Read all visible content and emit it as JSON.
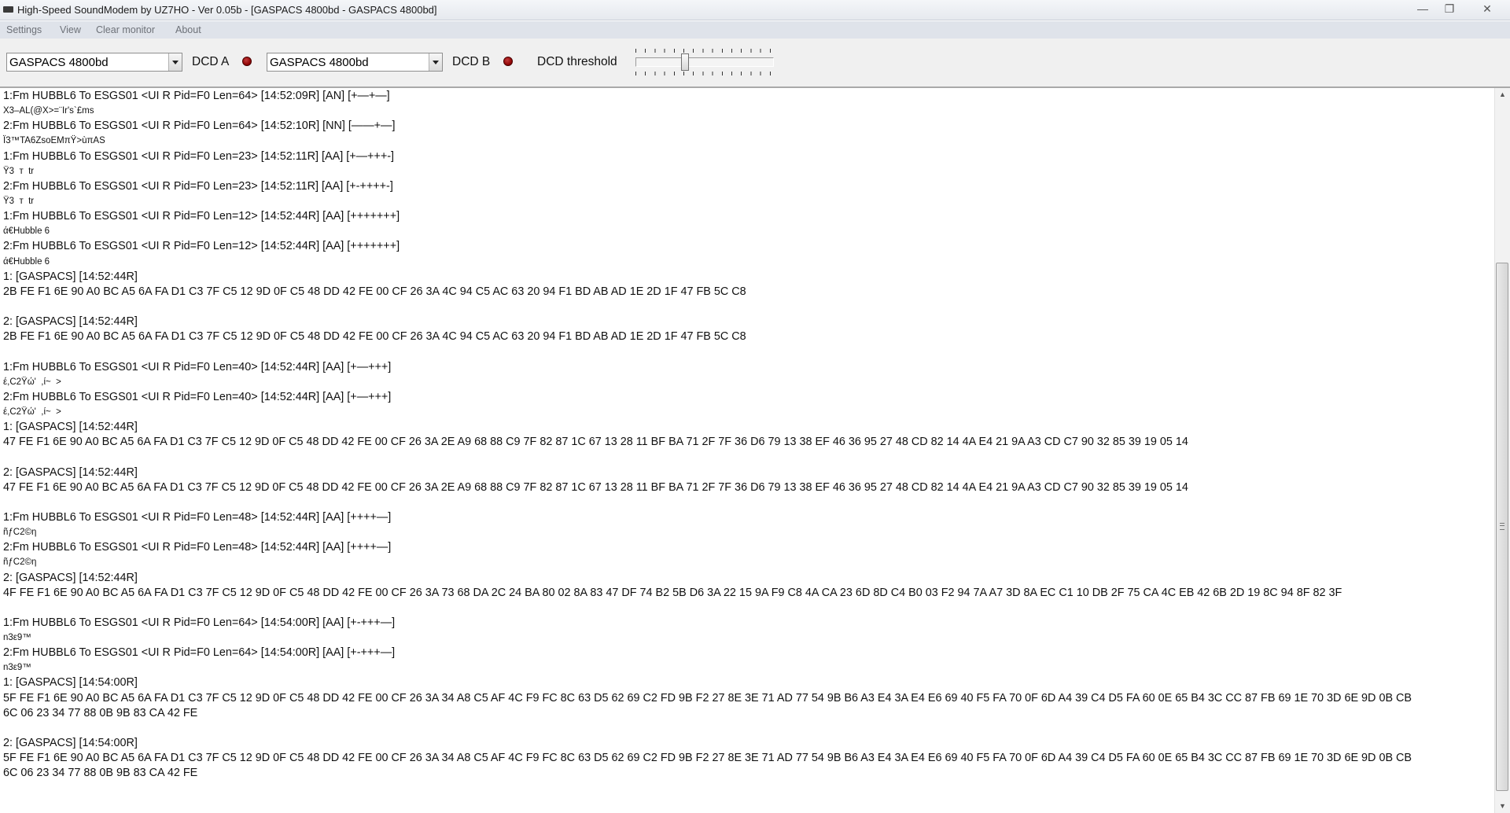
{
  "window": {
    "title": "High-Speed SoundModem by UZ7HO - Ver 0.05b - [GASPACS 4800bd - GASPACS 4800bd]",
    "controls": [
      "—",
      "❐",
      "✕"
    ]
  },
  "menu": [
    "Settings",
    "View",
    "Clear monitor",
    "About"
  ],
  "toolbar": {
    "modem_a": "GASPACS 4800bd",
    "dcd_a_label": "DCD A",
    "modem_b": "GASPACS 4800bd",
    "dcd_b_label": "DCD B",
    "dcd_threshold_label": "DCD threshold",
    "led_color": "#8b0000",
    "dcd_threshold_level": 0.35
  },
  "monitor": {
    "lines": [
      {
        "text": "1:Fm HUBBL6 To ESGS01 <UI R Pid=F0 Len=64> [14:52:09R] [AN] [+—+—]",
        "small": false
      },
      {
        "text": "X3–AL(@X>=¨Ir's`£ms",
        "small": true
      },
      {
        "text": "2:Fm HUBBL6 To ESGS01 <UI R Pid=F0 Len=64> [14:52:10R] [NN] [——+—]",
        "small": false
      },
      {
        "text": "Ï3™TA6ZsoEMπŸ>ùπAS",
        "small": true
      },
      {
        "text": "1:Fm HUBBL6 To ESGS01 <UI R Pid=F0 Len=23> [14:52:11R] [AA] [+—+++-]",
        "small": false
      },
      {
        "text": "Ÿ3  т  tr",
        "small": true
      },
      {
        "text": "2:Fm HUBBL6 To ESGS01 <UI R Pid=F0 Len=23> [14:52:11R] [AA] [+-++++-]",
        "small": false
      },
      {
        "text": "Ÿ3  т  tr",
        "small": true
      },
      {
        "text": "1:Fm HUBBL6 To ESGS01 <UI R Pid=F0 Len=12> [14:52:44R] [AA] [+++++++]",
        "small": false
      },
      {
        "text": "ά€Hubble 6",
        "small": true
      },
      {
        "text": "2:Fm HUBBL6 To ESGS01 <UI R Pid=F0 Len=12> [14:52:44R] [AA] [+++++++]",
        "small": false
      },
      {
        "text": "ά€Hubble 6",
        "small": true
      },
      {
        "text": "1: [GASPACS] [14:52:44R]",
        "small": false
      },
      {
        "text": "2B FE F1 6E 90 A0 BC A5 6A FA D1 C3 7F C5 12 9D 0F C5 48 DD 42 FE 00 CF 26 3A 4C 94 C5 AC 63 20 94 F1 BD AB AD 1E 2D 1F 47 FB 5C C8",
        "small": false
      },
      {
        "text": "",
        "small": false
      },
      {
        "text": "2: [GASPACS] [14:52:44R]",
        "small": false
      },
      {
        "text": "2B FE F1 6E 90 A0 BC A5 6A FA D1 C3 7F C5 12 9D 0F C5 48 DD 42 FE 00 CF 26 3A 4C 94 C5 AC 63 20 94 F1 BD AB AD 1E 2D 1F 47 FB 5C C8",
        "small": false
      },
      {
        "text": "",
        "small": false
      },
      {
        "text": "1:Fm HUBBL6 To ESGS01 <UI R Pid=F0 Len=40> [14:52:44R] [AA] [+—+++]",
        "small": false
      },
      {
        "text": "έ,C2Ÿώ'  ,ί~  >",
        "small": true
      },
      {
        "text": "2:Fm HUBBL6 To ESGS01 <UI R Pid=F0 Len=40> [14:52:44R] [AA] [+—+++]",
        "small": false
      },
      {
        "text": "έ,C2Ÿώ'  ,ί~  >",
        "small": true
      },
      {
        "text": "1: [GASPACS] [14:52:44R]",
        "small": false
      },
      {
        "text": "47 FE F1 6E 90 A0 BC A5 6A FA D1 C3 7F C5 12 9D 0F C5 48 DD 42 FE 00 CF 26 3A 2E A9 68 88 C9 7F 82 87 1C 67 13 28 11 BF BA 71 2F 7F 36 D6 79 13 38 EF 46 36 95 27 48 CD 82 14 4A E4 21 9A A3 CD C7 90 32 85 39 19 05 14",
        "small": false
      },
      {
        "text": "",
        "small": false
      },
      {
        "text": "2: [GASPACS] [14:52:44R]",
        "small": false
      },
      {
        "text": "47 FE F1 6E 90 A0 BC A5 6A FA D1 C3 7F C5 12 9D 0F C5 48 DD 42 FE 00 CF 26 3A 2E A9 68 88 C9 7F 82 87 1C 67 13 28 11 BF BA 71 2F 7F 36 D6 79 13 38 EF 46 36 95 27 48 CD 82 14 4A E4 21 9A A3 CD C7 90 32 85 39 19 05 14",
        "small": false
      },
      {
        "text": "",
        "small": false
      },
      {
        "text": "1:Fm HUBBL6 To ESGS01 <UI R Pid=F0 Len=48> [14:52:44R] [AA] [++++—]",
        "small": false
      },
      {
        "text": "ñƒC2©η",
        "small": true
      },
      {
        "text": "2:Fm HUBBL6 To ESGS01 <UI R Pid=F0 Len=48> [14:52:44R] [AA] [++++—]",
        "small": false
      },
      {
        "text": "ñƒC2©η",
        "small": true
      },
      {
        "text": "2: [GASPACS] [14:52:44R]",
        "small": false
      },
      {
        "text": "4F FE F1 6E 90 A0 BC A5 6A FA D1 C3 7F C5 12 9D 0F C5 48 DD 42 FE 00 CF 26 3A 73 68 DA 2C 24 BA 80 02 8A 83 47 DF 74 B2 5B D6 3A 22 15 9A F9 C8 4A CA 23 6D 8D C4 B0 03 F2 94 7A A7 3D 8A EC C1 10 DB 2F 75 CA 4C EB 42 6B 2D 19 8C 94 8F 82 3F",
        "small": false
      },
      {
        "text": "",
        "small": false
      },
      {
        "text": "1:Fm HUBBL6 To ESGS01 <UI R Pid=F0 Len=64> [14:54:00R] [AA] [+-+++—]",
        "small": false
      },
      {
        "text": "n3ε9™",
        "small": true
      },
      {
        "text": "2:Fm HUBBL6 To ESGS01 <UI R Pid=F0 Len=64> [14:54:00R] [AA] [+-+++—]",
        "small": false
      },
      {
        "text": "n3ε9™",
        "small": true
      },
      {
        "text": "1: [GASPACS] [14:54:00R]",
        "small": false
      },
      {
        "text": "5F FE F1 6E 90 A0 BC A5 6A FA D1 C3 7F C5 12 9D 0F C5 48 DD 42 FE 00 CF 26 3A 34 A8 C5 AF 4C F9 FC 8C 63 D5 62 69 C2 FD 9B F2 27 8E 3E 71 AD 77 54 9B B6 A3 E4 3A E4 E6 69 40 F5 FA 70 0F 6D A4 39 C4 D5 FA 60 0E 65 B4 3C CC 87 FB 69 1E 70 3D 6E 9D 0B CB",
        "small": false
      },
      {
        "text": "6C 06 23 34 77 88 0B 9B 83 CA 42 FE",
        "small": false
      },
      {
        "text": "",
        "small": false
      },
      {
        "text": "2: [GASPACS] [14:54:00R]",
        "small": false
      },
      {
        "text": "5F FE F1 6E 90 A0 BC A5 6A FA D1 C3 7F C5 12 9D 0F C5 48 DD 42 FE 00 CF 26 3A 34 A8 C5 AF 4C F9 FC 8C 63 D5 62 69 C2 FD 9B F2 27 8E 3E 71 AD 77 54 9B B6 A3 E4 3A E4 E6 69 40 F5 FA 70 0F 6D A4 39 C4 D5 FA 60 0E 65 B4 3C CC 87 FB 69 1E 70 3D 6E 9D 0B CB",
        "small": false
      },
      {
        "text": "6C 06 23 34 77 88 0B 9B 83 CA 42 FE",
        "small": false
      }
    ]
  },
  "scrollbar": {
    "up_arrow": "▲",
    "down_arrow": "▼",
    "scroll_position": 0.27
  }
}
